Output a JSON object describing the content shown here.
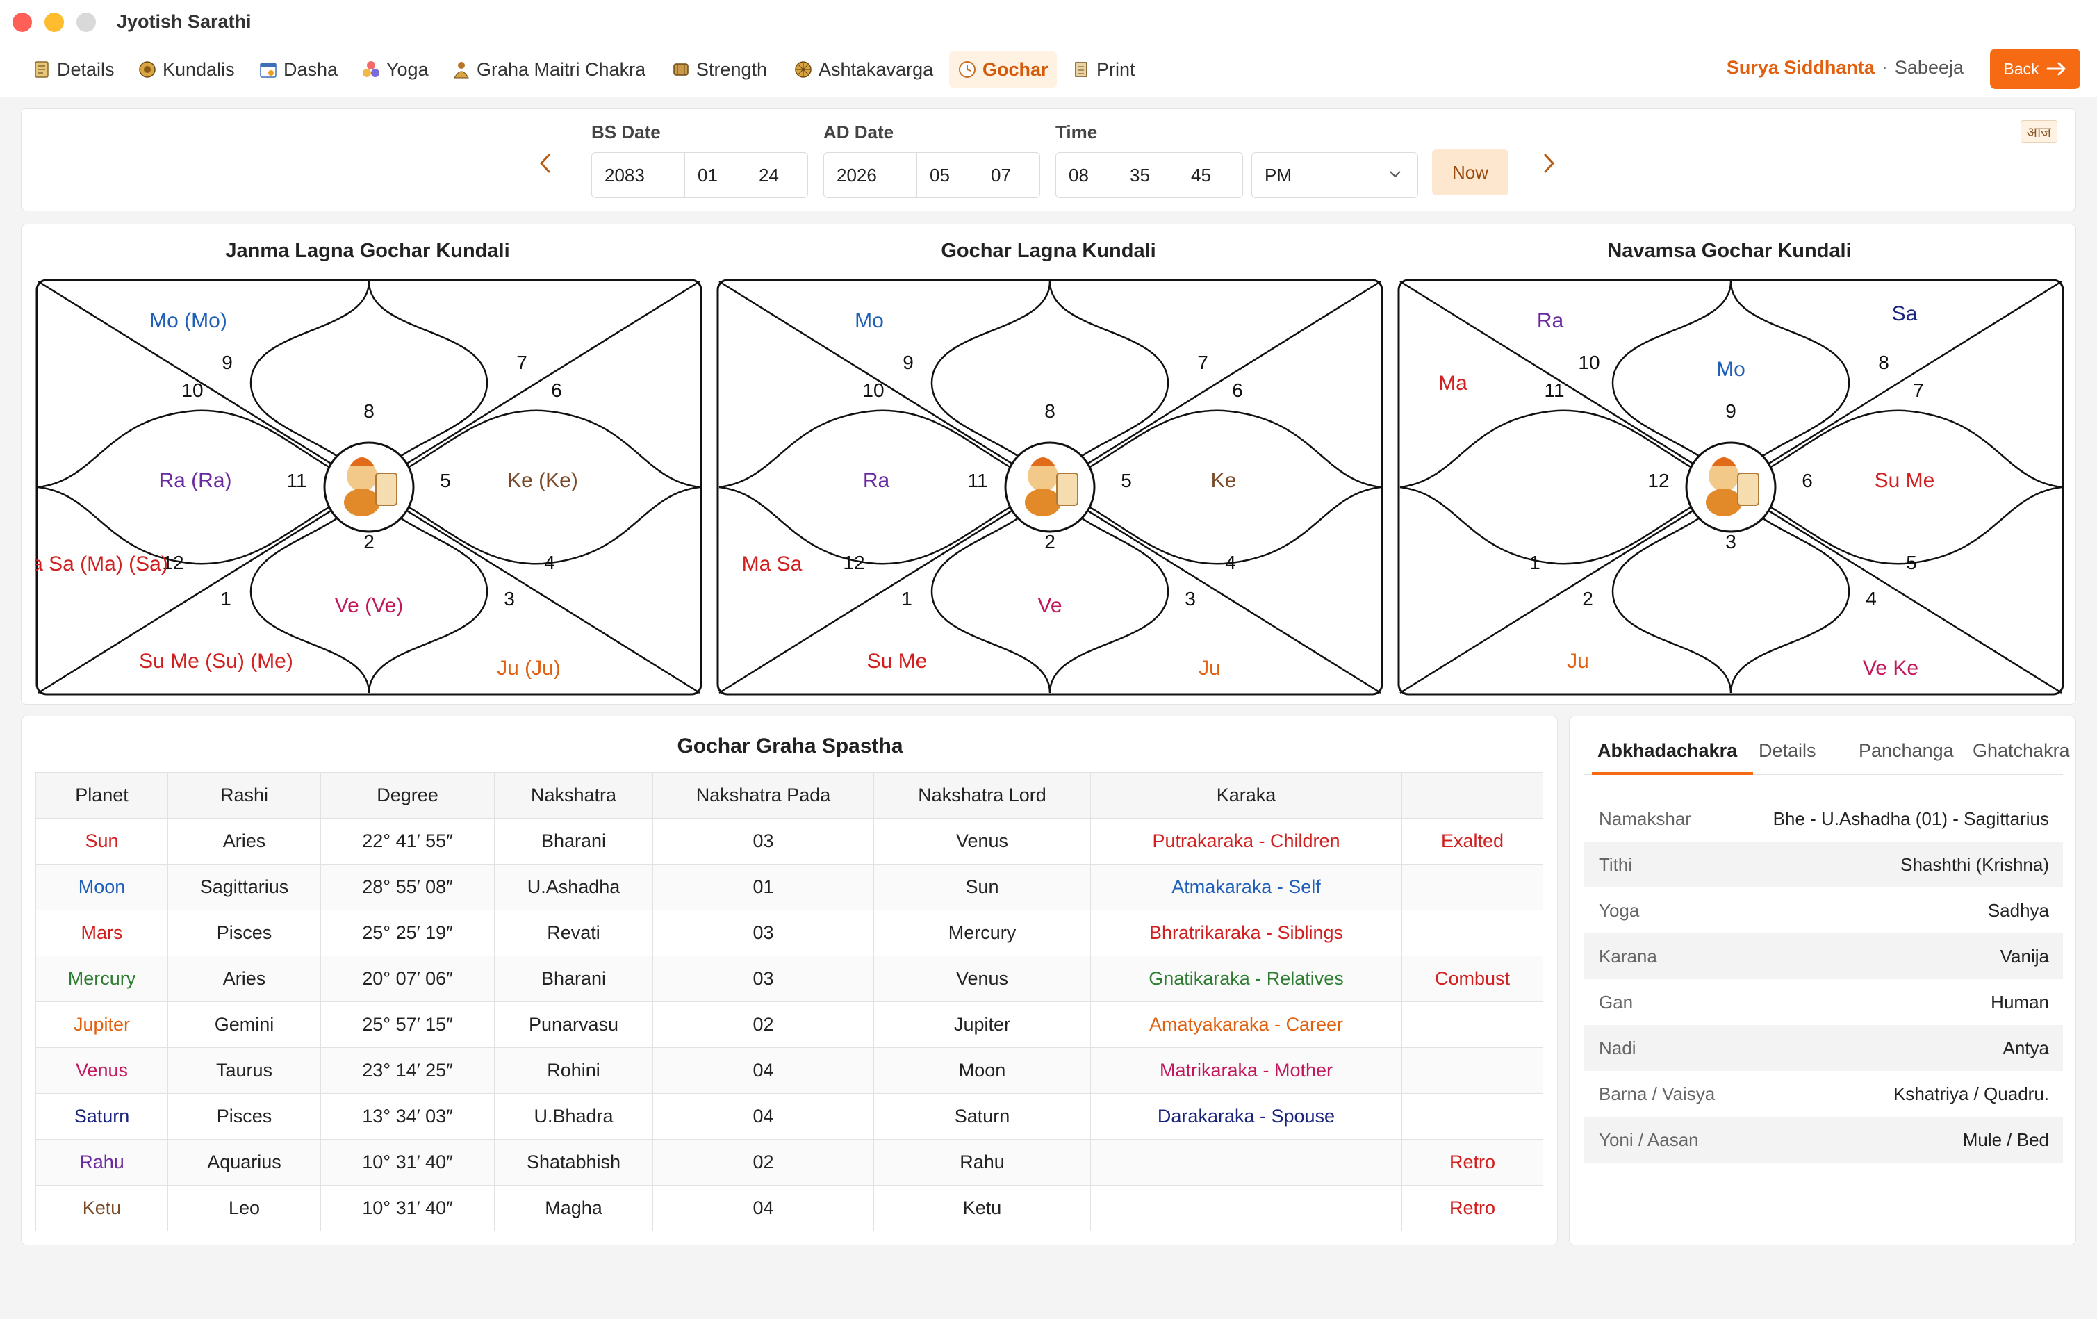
{
  "app": {
    "title": "Jyotish Sarathi"
  },
  "nav": {
    "items": [
      {
        "label": "Details",
        "icon": "details-icon"
      },
      {
        "label": "Kundalis",
        "icon": "kundali-icon"
      },
      {
        "label": "Dasha",
        "icon": "dasha-icon"
      },
      {
        "label": "Yoga",
        "icon": "yoga-icon"
      },
      {
        "label": "Graha Maitri Chakra",
        "icon": "maitri-icon"
      },
      {
        "label": "Strength",
        "icon": "strength-icon"
      },
      {
        "label": "Ashtakavarga",
        "icon": "ashtakavarga-icon"
      },
      {
        "label": "Gochar",
        "icon": "clock-icon",
        "active": true
      },
      {
        "label": "Print",
        "icon": "print-icon"
      }
    ],
    "siddhanta": "Surya Siddhanta",
    "separator": "·",
    "mode": "Sabeeja",
    "back_label": "Back"
  },
  "datebar": {
    "bs_label": "BS Date",
    "bs": {
      "year": "2083",
      "month": "01",
      "day": "24"
    },
    "ad_label": "AD Date",
    "ad": {
      "year": "2026",
      "month": "05",
      "day": "07"
    },
    "time_label": "Time",
    "time": {
      "hour": "08",
      "minute": "35",
      "second": "45"
    },
    "ampm": "PM",
    "now_label": "Now",
    "aaja_label": "आज"
  },
  "kundalis": [
    {
      "title": "Janma Lagna Gochar Kundali",
      "houses": [
        "8",
        "7",
        "6",
        "5",
        "4",
        "3",
        "2",
        "1",
        "12",
        "11",
        "10",
        "9"
      ],
      "planets": [
        {
          "house": 1,
          "text": "Mo (Mo)",
          "color": "#1f5fb8"
        },
        {
          "house": 4,
          "text": "Ra (Ra)",
          "color": "#6a2a9e"
        },
        {
          "house": 6,
          "text": "Su Me (Su) (Me)",
          "color": "#d12020"
        },
        {
          "house": 8,
          "text": "Ju (Ju)",
          "color": "#e06010"
        },
        {
          "house": 7,
          "text": "Ve (Ve)",
          "color": "#c2185b"
        },
        {
          "house": 10,
          "text": "Ke (Ke)",
          "color": "#7a4a28"
        },
        {
          "house": 5,
          "text": "Ma Sa (Ma) (Sa)",
          "color": "#d12020"
        }
      ]
    },
    {
      "title": "Gochar Lagna Kundali",
      "houses": [
        "8",
        "7",
        "6",
        "5",
        "4",
        "3",
        "2",
        "1",
        "12",
        "11",
        "10",
        "9"
      ],
      "planets": [
        {
          "house": 1,
          "text": "Mo",
          "color": "#1f5fb8"
        },
        {
          "house": 4,
          "text": "Ra",
          "color": "#6a2a9e"
        },
        {
          "house": 6,
          "text": "Su Me",
          "color": "#d12020"
        },
        {
          "house": 8,
          "text": "Ju",
          "color": "#e06010"
        },
        {
          "house": 7,
          "text": "Ve",
          "color": "#c2185b"
        },
        {
          "house": 10,
          "text": "Ke",
          "color": "#7a4a28"
        },
        {
          "house": 5,
          "text": "Ma Sa",
          "color": "#d12020"
        }
      ]
    },
    {
      "title": "Navamsa Gochar Kundali",
      "houses": [
        "9",
        "8",
        "7",
        "6",
        "5",
        "4",
        "3",
        "2",
        "1",
        "12",
        "11",
        "10"
      ],
      "planets": [
        {
          "house": 0,
          "text": "Mo",
          "color": "#1f5fb8"
        },
        {
          "house": 1,
          "text": "Ra",
          "color": "#6a2a9e"
        },
        {
          "house": 2,
          "text": "Ma",
          "color": "#d12020"
        },
        {
          "house": 11,
          "text": "Sa",
          "color": "#1a237e"
        },
        {
          "house": 10,
          "text": "Su Me",
          "color": "#d12020"
        },
        {
          "house": 6,
          "text": "Ju",
          "color": "#e06010"
        },
        {
          "house": 8,
          "text": "Ve Ke",
          "color": "#c2185b"
        }
      ]
    }
  ],
  "graha": {
    "title": "Gochar Graha Spastha",
    "columns": [
      "Planet",
      "Rashi",
      "Degree",
      "Nakshatra",
      "Nakshatra Pada",
      "Nakshatra Lord",
      "Karaka",
      ""
    ],
    "rows": [
      {
        "planet": "Sun",
        "pcolor": "#d12020",
        "rashi": "Aries",
        "degree": "22° 41′ 55″",
        "nakshatra": "Bharani",
        "pada": "03",
        "lord": "Venus",
        "karaka": "Putrakaraka - Children",
        "kcolor": "#d12020",
        "status": "Exalted"
      },
      {
        "planet": "Moon",
        "pcolor": "#1f5fb8",
        "rashi": "Sagittarius",
        "degree": "28° 55′ 08″",
        "nakshatra": "U.Ashadha",
        "pada": "01",
        "lord": "Sun",
        "karaka": "Atmakaraka - Self",
        "kcolor": "#1f5fb8",
        "status": ""
      },
      {
        "planet": "Mars",
        "pcolor": "#d12020",
        "rashi": "Pisces",
        "degree": "25° 25′ 19″",
        "nakshatra": "Revati",
        "pada": "03",
        "lord": "Mercury",
        "karaka": "Bhratrikaraka - Siblings",
        "kcolor": "#d12020",
        "status": ""
      },
      {
        "planet": "Mercury",
        "pcolor": "#2e7d32",
        "rashi": "Aries",
        "degree": "20° 07′ 06″",
        "nakshatra": "Bharani",
        "pada": "03",
        "lord": "Venus",
        "karaka": "Gnatikaraka - Relatives",
        "kcolor": "#2e7d32",
        "status": "Combust"
      },
      {
        "planet": "Jupiter",
        "pcolor": "#e06010",
        "rashi": "Gemini",
        "degree": "25° 57′ 15″",
        "nakshatra": "Punarvasu",
        "pada": "02",
        "lord": "Jupiter",
        "karaka": "Amatyakaraka - Career",
        "kcolor": "#e06010",
        "status": ""
      },
      {
        "planet": "Venus",
        "pcolor": "#c2185b",
        "rashi": "Taurus",
        "degree": "23° 14′ 25″",
        "nakshatra": "Rohini",
        "pada": "04",
        "lord": "Moon",
        "karaka": "Matrikaraka - Mother",
        "kcolor": "#c2185b",
        "status": ""
      },
      {
        "planet": "Saturn",
        "pcolor": "#1a237e",
        "rashi": "Pisces",
        "degree": "13° 34′ 03″",
        "nakshatra": "U.Bhadra",
        "pada": "04",
        "lord": "Saturn",
        "karaka": "Darakaraka - Spouse",
        "kcolor": "#1a237e",
        "status": ""
      },
      {
        "planet": "Rahu",
        "pcolor": "#6a2a9e",
        "rashi": "Aquarius",
        "degree": "10° 31′ 40″",
        "nakshatra": "Shatabhish",
        "pada": "02",
        "lord": "Rahu",
        "karaka": "",
        "kcolor": "#222",
        "status": "Retro"
      },
      {
        "planet": "Ketu",
        "pcolor": "#7a4a28",
        "rashi": "Leo",
        "degree": "10° 31′ 40″",
        "nakshatra": "Magha",
        "pada": "04",
        "lord": "Ketu",
        "karaka": "",
        "kcolor": "#222",
        "status": "Retro"
      }
    ],
    "status_color": "#d12020"
  },
  "info": {
    "tabs": [
      "Abkhadachakra",
      "Details",
      "Panchanga",
      "Ghatchakra"
    ],
    "active_tab": 0,
    "rows": [
      {
        "key": "Namakshar",
        "value": "Bhe - U.Ashadha (01) - Sagittarius"
      },
      {
        "key": "Tithi",
        "value": "Shashthi (Krishna)"
      },
      {
        "key": "Yoga",
        "value": "Sadhya"
      },
      {
        "key": "Karana",
        "value": "Vanija"
      },
      {
        "key": "Gan",
        "value": "Human"
      },
      {
        "key": "Nadi",
        "value": "Antya"
      },
      {
        "key": "Barna / Vaisya",
        "value": "Kshatriya / Quadru."
      },
      {
        "key": "Yoni / Aasan",
        "value": "Mule / Bed"
      }
    ]
  }
}
